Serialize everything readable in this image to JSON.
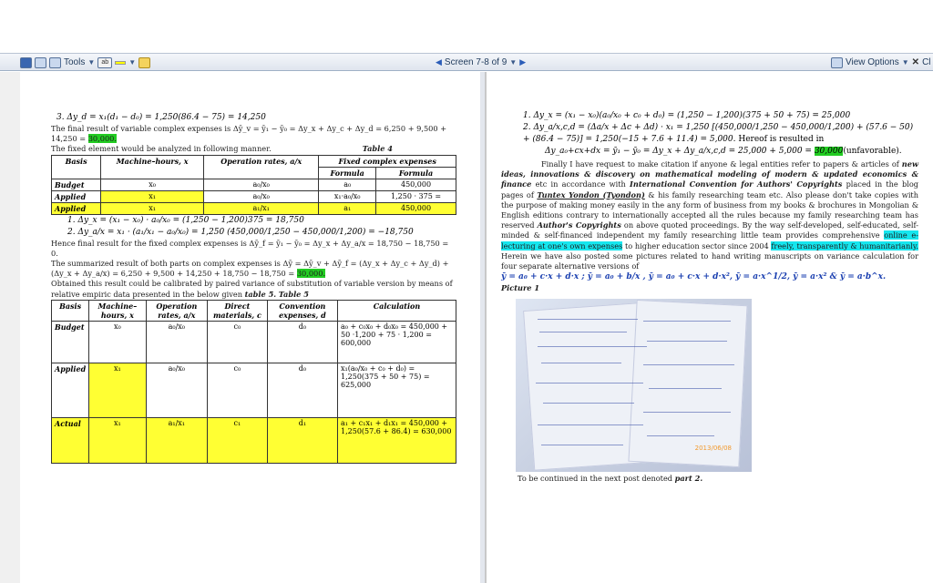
{
  "toolbar": {
    "tools_label": "Tools",
    "highlight_label": "ab",
    "screen_label": "Screen 7-8 of 9",
    "view_options": "View Options",
    "close_label": "Cl"
  },
  "left": {
    "eq3": "3. Δy_d = x₁(d₁ − d₀) = 1,250(86.4 − 75) = 14,250",
    "para1a": "The final result of variable complex expenses is Δȳ_v = ȳ₁ − ȳ₀ = Δy_x + Δy_c + Δy_d = 6,250 + 9,500 + 14,250 = ",
    "para1_hl": "30,000.",
    "para2": "The fixed element would be analyzed in following manner.",
    "table4_title": "Table 4",
    "t4_headers": [
      "Basis",
      "Machine–hours, x",
      "Operation rates, a/x",
      "Fixed complex expenses",
      "Formula",
      "Formula"
    ],
    "t4_rows": [
      [
        "Budget",
        "x₀",
        "a₀/x₀",
        "a₀",
        "450,000"
      ],
      [
        "Applied",
        "x₁",
        "a₀/x₀",
        "x₁·a₀/x₀",
        "1,250 · 375 ="
      ],
      [
        "Applied",
        "x₁",
        "a₁/x₁",
        "a₁",
        "450,000"
      ]
    ],
    "eqA1": "1. Δy_x = (x₁ − x₀) · a₀/x₀ = (1,250 − 1,200)375 = 18,750",
    "eqA2": "2. Δy_a/x = x₁ · (a₁/x₁ − a₀/x₀) = 1,250 (450,000/1,250 − 450,000/1,200) = −18,750",
    "para3": "Hence final result for the fixed complex expenses is Δȳ_f = ȳ₁ − ȳ₀ = Δy_x + Δy_a/x = 18,750 − 18,750 = 0.",
    "para4a": "The summarized result of both parts on complex expenses is Δȳ = Δȳ_v + Δȳ_f = (Δy_x + Δy_c + Δy_d) + (Δy_x + Δy_a/x) = 6,250 + 9,500 + 14,250 + 18,750 − 18,750 = ",
    "para4_hl": "30,000.",
    "para5a": "Obtained this result could be calibrated by paired variance of substitution of variable version by means of relative empiric data presented in the below given ",
    "para5_tbl": "table 5.",
    "table5_title": "Table 5",
    "t5_headers": [
      "Basis",
      "Machine–hours, x",
      "Operation rates, a/x",
      "Direct materials, c",
      "Convention expenses, d",
      "Calculation"
    ],
    "t5_rows": [
      [
        "Budget",
        "x₀",
        "a₀/x₀",
        "c₀",
        "d₀",
        "a₀ + c₀x₀ + d₀x₀ = 450,000 + 50 ·1,200 + 75 · 1,200 = 600,000"
      ],
      [
        "Applied",
        "x₁",
        "a₀/x₀",
        "c₀",
        "d₀",
        "x₁(a₀/x₀ + c₀ + d₀) = 1,250(375 + 50 + 75) = 625,000"
      ],
      [
        "Actual",
        "x₁",
        "a₁/x₁",
        "c₁",
        "d₁",
        "a₁ + c₁x₁ + d₁x₁ = 450,000 + 1,250(57.6 + 86.4) = 630,000"
      ]
    ]
  },
  "right": {
    "eqR1": "1. Δy_x = (x₁ − x₀)(a₀/x₀ + c₀ + d₀) = (1,250 − 1,200)(375 + 50 + 75) = 25,000",
    "eqR2": "2. Δy_a/x,c,d = (Δa/x + Δc + Δd) · x₁ = 1,250 [(450,000/1,250 − 450,000/1,200) + (57.6 − 50) + (86.4 − 75)] = 1,250(−15 + 7.6 + 11.4) = 5,000.",
    "eqR2_tail": "Hereof is resulted in",
    "eqR3": "Δy_a₀+cx+dx = ȳ₁ − ȳ₀ = Δy_x + Δy_a/x,c,d = 25,000 + 5,000 =",
    "eqR3_hl": "30,000",
    "eqR3_tail": "(unfavorable).",
    "par_a": "Finally I have request to make citation if anyone & legal entities refer to papers & articles of ",
    "par_b": "new ideas, innovations & discovery on mathematical modeling of modern & updated economics & finance",
    "par_c": " etc in accordance with ",
    "par_d": "International Convention for Authors' Copyrights",
    "par_e": " placed in the blog pages of ",
    "par_f": "Tuntex Yondon (Tyondon)",
    "par_g": " & his family researching team etc. Also please don't take copies with the purpose of making money easily in the any form of business from my books & brochures in Mongolian & English editions contrary to internationally accepted all the rules because my family researching team has reserved ",
    "par_h": "Author's Copyrights",
    "par_i": " on above quoted proceedings. By the way self-developed, self-educated, self-minded & self-financed independent my family researching little team provides comprehensive ",
    "par_j": "online e-lecturing at one's own expenses",
    "par_k": " to higher education sector since 2004 ",
    "par_l": "freely, transparently & humanitarianly.",
    "par_m": " Herein we have also posted some pictures related to hand writing manuscripts on variance calculation for four separate alternative versions of",
    "versions": "ȳ = a₀ + c·x + d·x ; ȳ = a₀ + b/x , ȳ = a₀ + c·x + d·x², ȳ = a·x^1/2, ȳ = a·x² & ȳ = a·b^x.",
    "picture_label": "Picture 1",
    "photo_date": "2013/06/08",
    "continued_a": "To be continued in the next post denoted ",
    "continued_b": "part 2."
  }
}
